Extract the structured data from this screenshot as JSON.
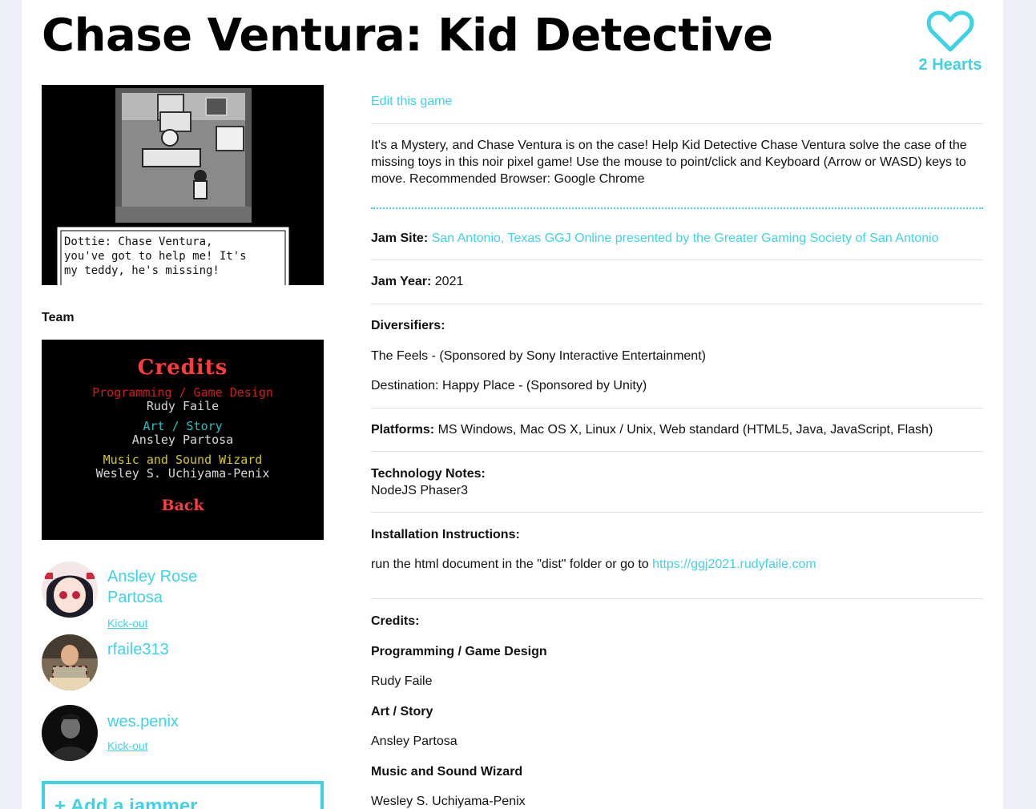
{
  "game": {
    "title": "Chase Ventura: Kid Detective",
    "hearts": "2 Hearts",
    "edit_link": "Edit this game",
    "description": "It's a Mystery, and Chase Ventura is on the case! Help Kid Detective Chase Ventura solve the case of the missing toys in this noir pixel game! Use the mouse to point/click and Keyboard (Arrow or WASD) keys to move. Recommended Browser: Google Chrome"
  },
  "screenshot1": {
    "dialog": "Dottie: Chase Ventura,\nyou've got to help me! It's\nmy teddy, he's missing!"
  },
  "screenshot2": {
    "heading": "Credits",
    "role1": "Programming / Game Design",
    "name1": "Rudy Faile",
    "role2": "Art / Story",
    "name2": "Ansley Partosa",
    "role3": "Music and Sound Wizard",
    "name3": "Wesley S. Uchiyama-Penix",
    "back": "Back"
  },
  "team": {
    "label": "Team",
    "members": [
      {
        "name": "Ansley Rose Partosa",
        "action": "Kick-out"
      },
      {
        "name": "rfaile313",
        "action": ""
      },
      {
        "name": "wes.penix",
        "action": "Kick-out"
      }
    ],
    "add_button": "+ Add a jammer"
  },
  "details": {
    "jam_site_label": "Jam Site:",
    "jam_site": "San Antonio, Texas GGJ Online presented by the Greater Gaming Society of San Antonio",
    "jam_year_label": "Jam Year:",
    "jam_year": "2021",
    "diversifiers_label": "Diversifiers:",
    "diversifier1": "The Feels - (Sponsored by Sony Interactive Entertainment)",
    "diversifier2": "Destination: Happy Place - (Sponsored by Unity)",
    "platforms_label": "Platforms:",
    "platforms": "MS Windows, Mac OS X, Linux / Unix, Web standard (HTML5, Java, JavaScript, Flash)",
    "tech_label": "Technology Notes:",
    "tech": "NodeJS Phaser3",
    "install_label": "Installation Instructions:",
    "install_text": "run the html document in the \"dist\" folder or go to",
    "install_link": "https://ggj2021.rudyfaile.com",
    "credits_label": "Credits:",
    "credit_role1": "Programming / Game Design",
    "credit_name1": "Rudy Faile",
    "credit_role2": "Art / Story",
    "credit_name2": "Ansley Partosa",
    "credit_role3": "Music and Sound Wizard",
    "credit_name3": "Wesley S. Uchiyama-Penix"
  },
  "colors": {
    "accent": "#3fd2e6",
    "background": "#eeeef7"
  }
}
